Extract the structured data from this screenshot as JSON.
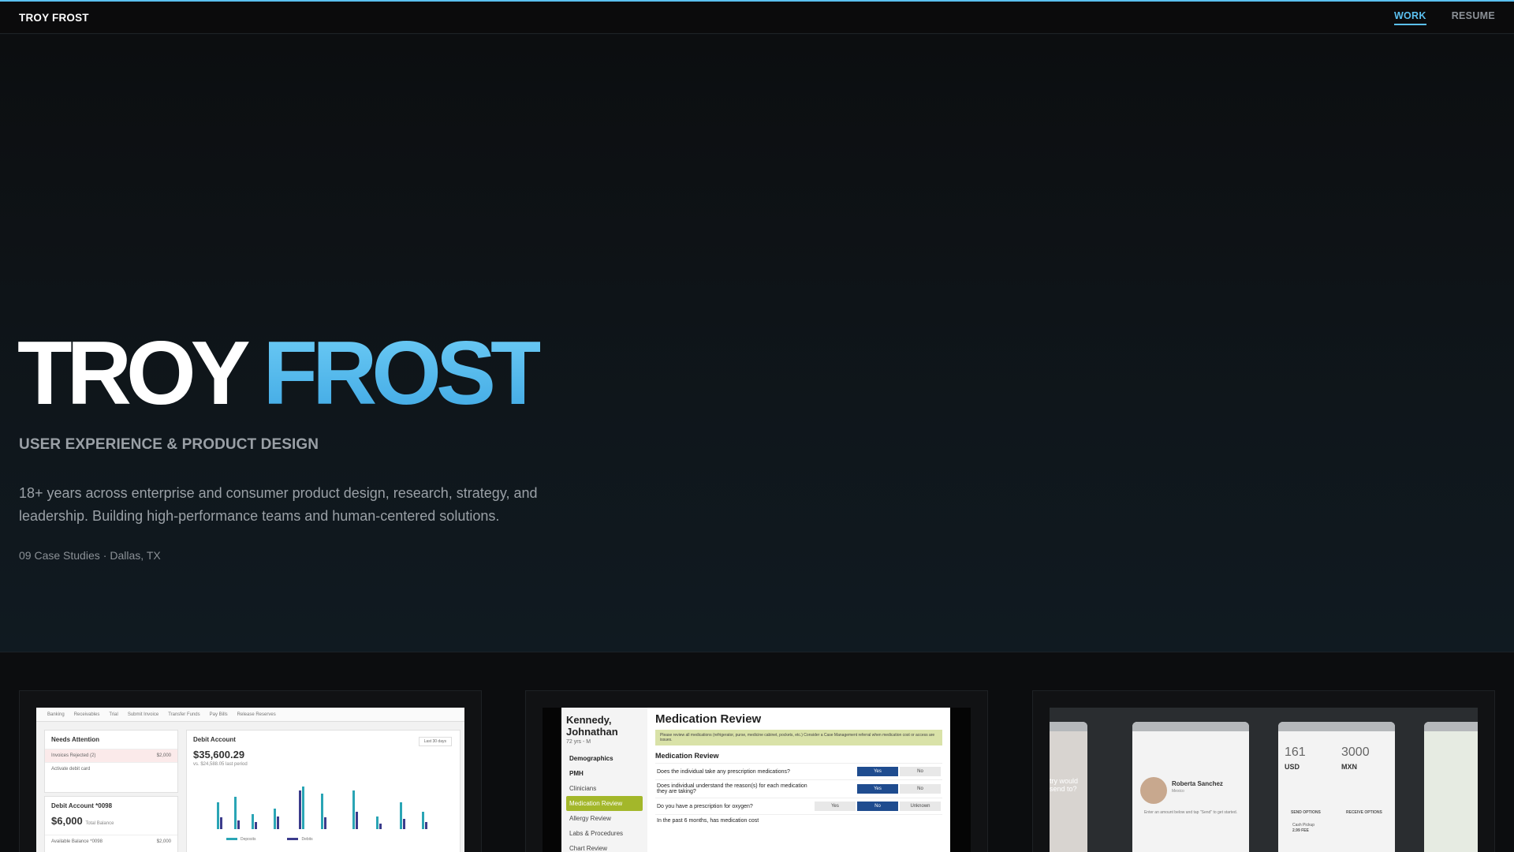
{
  "header": {
    "brand": "TROY FROST",
    "nav": [
      {
        "label": "WORK",
        "active": true
      },
      {
        "label": "RESUME",
        "active": false
      }
    ]
  },
  "hero": {
    "title_first": "TROY",
    "title_last": "FROST",
    "subtitle": "USER EXPERIENCE & PRODUCT DESIGN",
    "description": "18+ years across enterprise and consumer product design, research, strategy, and leadership. Building high-performance teams and human-centered solutions.",
    "case_studies": "09 Case Studies",
    "separator": "·",
    "location": "Dallas, TX"
  },
  "colors": {
    "accent": "#5bc0f0",
    "background": "#0d1013",
    "muted_text": "#9aa0a6"
  },
  "cards": [
    {
      "tabs": [
        "Banking",
        "Receivables",
        "Trial",
        "Submit Invoice",
        "Transfer Funds",
        "Pay Bills",
        "Release Reserves"
      ],
      "attention_title": "Needs Attention",
      "attention_rows": [
        {
          "label": "Invoices Rejected (2)",
          "value": "$2,000"
        },
        {
          "label": "Activate debit card",
          "value": ""
        }
      ],
      "debit_title": "Debit Account *0098",
      "debit_amount": "$6,000",
      "debit_sub": "Total Balance",
      "available_label": "Available Balance *0098",
      "available_value": "$2,000",
      "chart_title": "Debit Account",
      "chart_amount": "$35,600.29",
      "chart_compare": "vs. $24,588.05 last period",
      "chart_range": "Last 30 days",
      "legend": [
        "Deposits",
        "Debits"
      ]
    },
    {
      "patient_name": "Kennedy, Johnathan",
      "patient_info": "72 yrs - M",
      "sidebar": [
        "Demographics",
        "PMH",
        "Clinicians",
        "Medication Review",
        "Allergy Review",
        "Labs & Procedures",
        "Chart Review"
      ],
      "title": "Medication Review",
      "note": "Please review all medications (refrigerator, purse, medicine cabinet, pockets, etc.) Consider a Case Management referral when medication cost or access are issues.",
      "section": "Medication Review",
      "questions": [
        {
          "text": "Does the individual take any prescription medications?",
          "options": [
            "Yes",
            "No"
          ],
          "selected": 0
        },
        {
          "text": "Does individual understand the reason(s) for each medication they are taking?",
          "options": [
            "Yes",
            "No"
          ],
          "selected": 0
        },
        {
          "text": "Do you have a prescription for oxygen?",
          "options": [
            "Yes",
            "No",
            "Unknown"
          ],
          "selected": 1
        },
        {
          "text": "In the past 6 months, has medication cost",
          "options": [],
          "selected": -1
        }
      ]
    },
    {
      "contact_name": "Roberta Sanchez",
      "contact_location": "Mexico",
      "contact_prompt": "Enter an amount below and tap \"Send\" to get started.",
      "send_amount": "161",
      "receive_amount": "3000",
      "send_currency": "USD",
      "receive_currency": "MXN",
      "send_options": "SEND OPTIONS",
      "receive_options": "RECEIVE OPTIONS",
      "fee": "2.99 FEE",
      "cash_pickup": "Cash Pickup",
      "side_prompt": "try would send to?"
    }
  ]
}
